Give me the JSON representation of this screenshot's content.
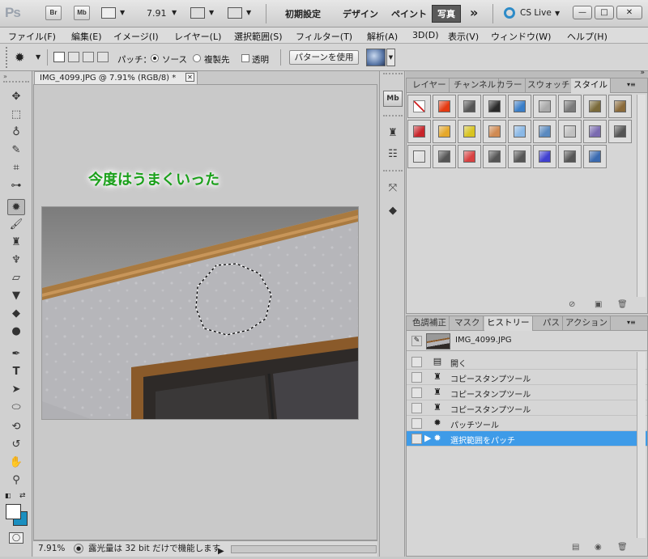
{
  "appbar": {
    "logo": "Ps",
    "bridge": "Br",
    "minibridge": "Mb",
    "zoom": "7.91",
    "workspaces": [
      "初期設定",
      "デザイン",
      "ペイント"
    ],
    "active_workspace": "写真",
    "more": "»",
    "cs_live": "CS Live",
    "window_buttons": [
      "—",
      "□",
      "✕"
    ]
  },
  "menubar": {
    "items": [
      "ファイル(F)",
      "編集(E)",
      "イメージ(I)",
      "レイヤー(L)",
      "選択範囲(S)",
      "フィルター(T)",
      "解析(A)",
      "3D(D)",
      "表示(V)",
      "ウィンドウ(W)",
      "ヘルプ(H)"
    ]
  },
  "options": {
    "patch_label": "パッチ：",
    "source_label": "ソース",
    "dest_label": "複製先",
    "transparent_label": "透明",
    "use_pattern_button": "パターンを使用",
    "source_selected": true
  },
  "document": {
    "tab_title": "IMG_4099.JPG @ 7.91% (RGB/8) *",
    "close": "✕",
    "caption": "今度はうまくいった",
    "caption_color": "#1aa01a"
  },
  "status": {
    "zoom": "7.91%",
    "message": "露光量は 32 bit だけで機能します"
  },
  "styles_panel": {
    "tabs": [
      "レイヤー",
      "チャンネル",
      "カラー",
      "スウォッチ",
      "スタイル"
    ],
    "active_tab": "スタイル",
    "swatches": [
      [
        "none",
        "#e43a12",
        "#555555",
        "#2a2a2a",
        "#3a7ec8",
        "#aaaaaa",
        "#7a7a7a",
        "#7a6a3a",
        "#8a6a3a"
      ],
      [
        "#c8242a",
        "#e6a82a",
        "#d8c420",
        "#d08a52",
        "#8ab8e6",
        "#5a8ac0",
        "#c0c0c0",
        "#7a6ab0",
        "#555555"
      ],
      [
        "#e0e0e0",
        "#555555",
        "#d84040",
        "#555555",
        "#555555",
        "#4040d0",
        "#555555",
        "#3a6ab0"
      ]
    ]
  },
  "history_panel": {
    "tabs": [
      "色調補正",
      "マスク",
      "ヒストリー",
      "パス",
      "アクション"
    ],
    "active_tab": "ヒストリー",
    "snapshot": "IMG_4099.JPG",
    "items": [
      {
        "icon": "doc-icon",
        "glyph": "▤",
        "label": "開く"
      },
      {
        "icon": "stamp-icon",
        "glyph": "♜",
        "label": "コピースタンプツール"
      },
      {
        "icon": "stamp-icon",
        "glyph": "♜",
        "label": "コピースタンプツール"
      },
      {
        "icon": "stamp-icon",
        "glyph": "♜",
        "label": "コピースタンプツール"
      },
      {
        "icon": "patch-icon",
        "glyph": "✹",
        "label": "パッチツール"
      },
      {
        "icon": "patch-icon",
        "glyph": "✹",
        "label": "選択範囲をパッチ"
      }
    ],
    "selected_index": 5
  },
  "colors": {
    "foreground": "#ffffff",
    "background": "#1a8fc0",
    "selection_blue": "#3e9be8"
  }
}
